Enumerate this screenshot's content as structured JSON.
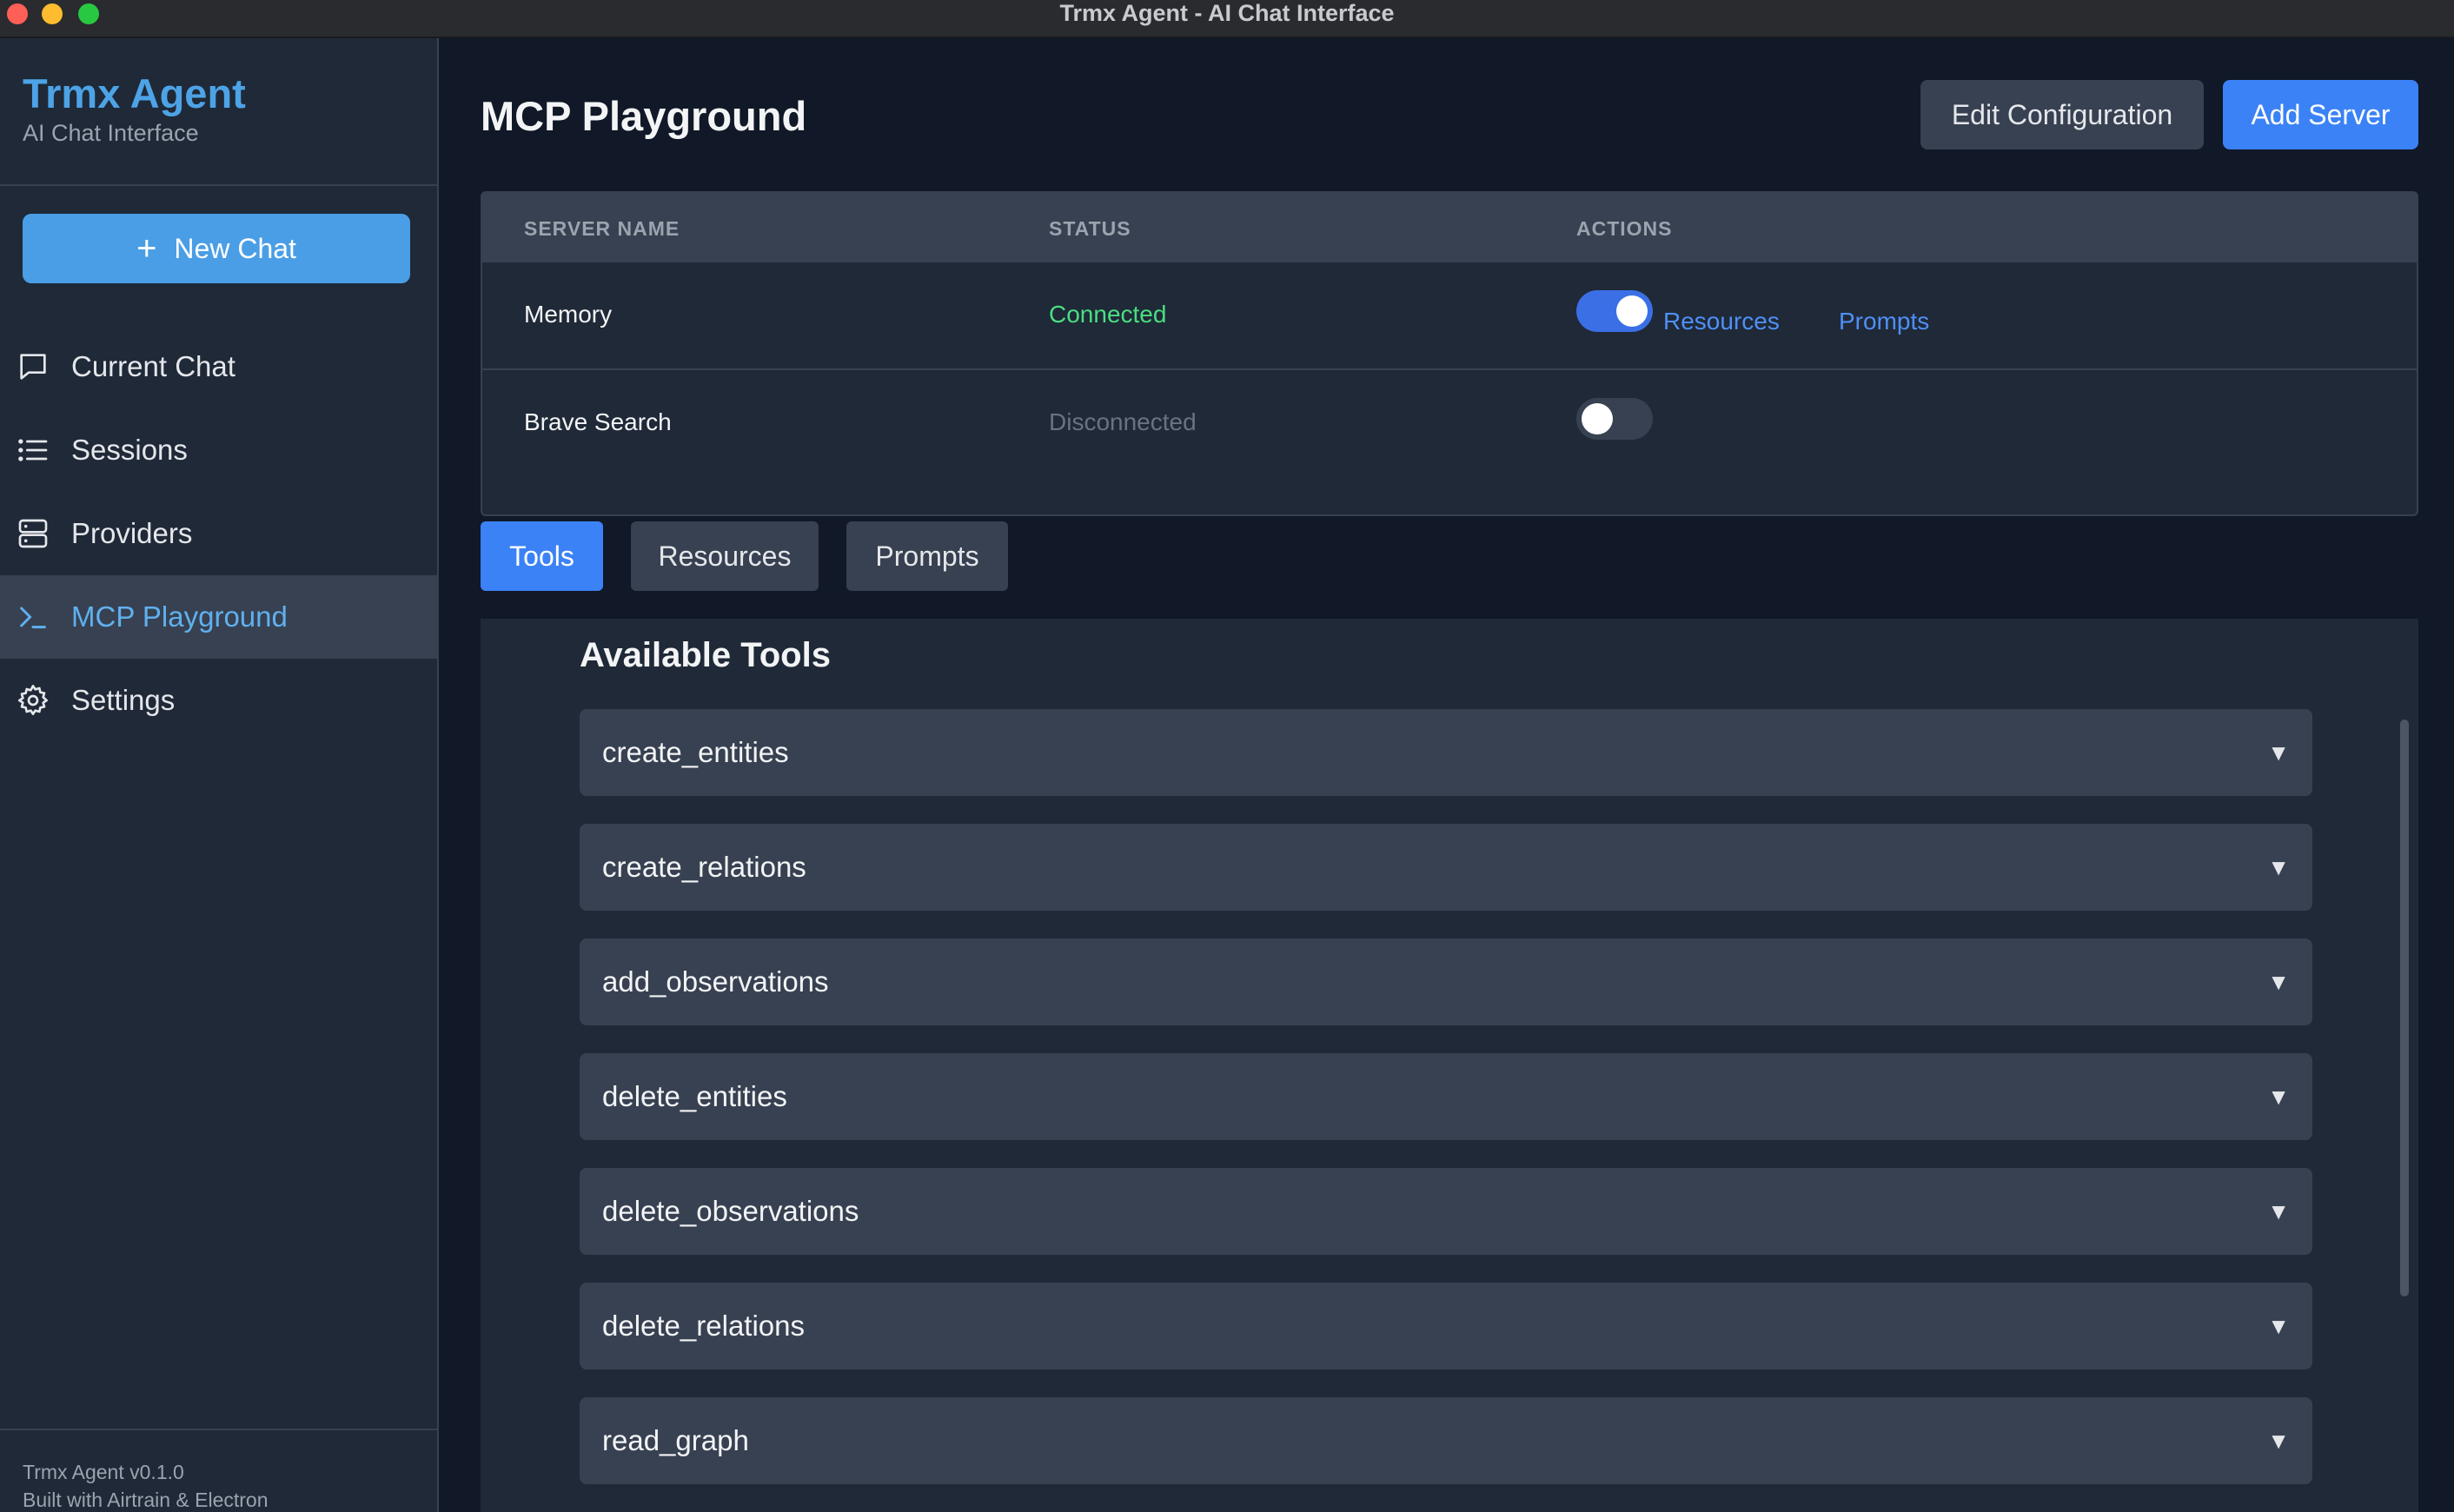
{
  "window": {
    "title": "Trmx Agent - AI Chat Interface"
  },
  "sidebar": {
    "brand_title": "Trmx Agent",
    "brand_subtitle": "AI Chat Interface",
    "new_chat_label": "New Chat",
    "items": [
      {
        "label": "Current Chat",
        "icon": "chat-bubble-icon",
        "active": false
      },
      {
        "label": "Sessions",
        "icon": "list-icon",
        "active": false
      },
      {
        "label": "Providers",
        "icon": "server-icon",
        "active": false
      },
      {
        "label": "MCP Playground",
        "icon": "terminal-icon",
        "active": true
      },
      {
        "label": "Settings",
        "icon": "gear-icon",
        "active": false
      }
    ],
    "footer_version": "Trmx Agent v0.1.0",
    "footer_built": "Built with Airtrain & Electron"
  },
  "main": {
    "title": "MCP Playground",
    "edit_config_label": "Edit Configuration",
    "add_server_label": "Add Server",
    "server_table": {
      "headers": [
        "SERVER NAME",
        "STATUS",
        "ACTIONS"
      ],
      "rows": [
        {
          "name": "Memory",
          "status": "Connected",
          "enabled": true,
          "links": [
            "Resources",
            "Prompts"
          ]
        },
        {
          "name": "Brave Search",
          "status": "Disconnected",
          "enabled": false,
          "links": []
        }
      ]
    },
    "tabs": [
      {
        "label": "Tools",
        "active": true
      },
      {
        "label": "Resources",
        "active": false
      },
      {
        "label": "Prompts",
        "active": false
      }
    ],
    "tools_title": "Available Tools",
    "tools": [
      "create_entities",
      "create_relations",
      "add_observations",
      "delete_entities",
      "delete_observations",
      "delete_relations",
      "read_graph"
    ],
    "chevron": "▼"
  },
  "colors": {
    "accent": "#3b82f6",
    "brand": "#4da3e6",
    "connected": "#4ade80",
    "disconnected": "#6b7280",
    "link": "#4f8ff7"
  }
}
